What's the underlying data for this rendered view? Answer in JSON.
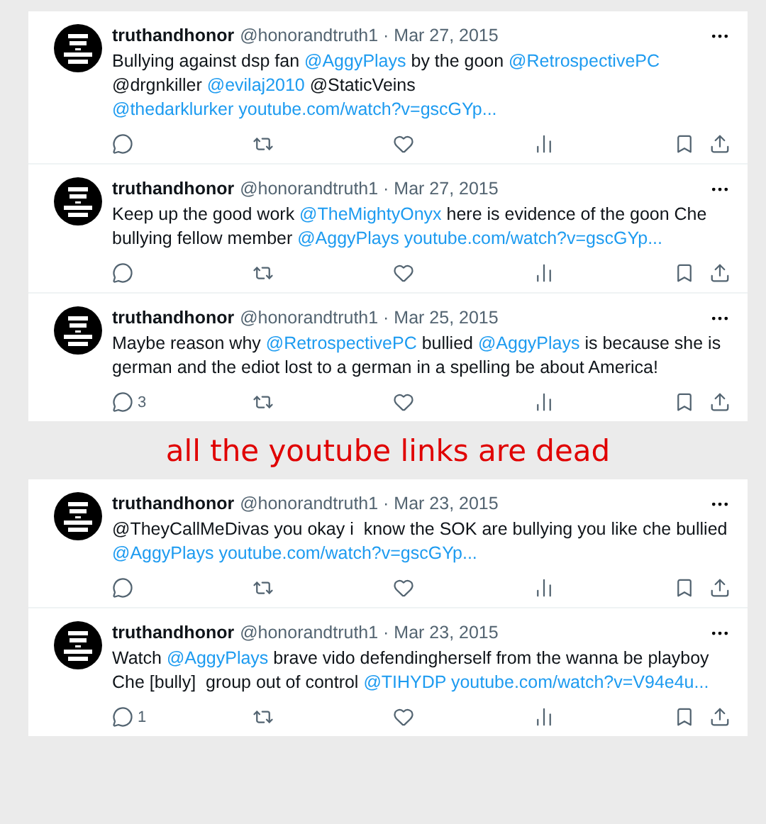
{
  "panels": [
    {
      "tweets": [
        {
          "name": "truthandhonor",
          "handle": "@honorandtruth1 · Mar 27, 2015",
          "segments": [
            {
              "text": "Bullying against dsp fan ",
              "kind": "text"
            },
            {
              "text": "@AggyPlays",
              "kind": "link"
            },
            {
              "text": " by the goon ",
              "kind": "text"
            },
            {
              "text": "@RetrospectivePC",
              "kind": "link"
            },
            {
              "text": " @drgnkiller ",
              "kind": "text"
            },
            {
              "text": "@evilaj2010",
              "kind": "link"
            },
            {
              "text": " @StaticVeins ",
              "kind": "text"
            },
            {
              "text": "@thedarklurker ",
              "kind": "link"
            },
            {
              "text": "youtube.com/watch?v=gscGYp...",
              "kind": "link"
            }
          ]
        },
        {
          "name": "truthandhonor",
          "handle": "@honorandtruth1 · Mar 27, 2015",
          "segments": [
            {
              "text": "Keep up the good work ",
              "kind": "text"
            },
            {
              "text": "@TheMightyOnyx",
              "kind": "link"
            },
            {
              "text": " here is evidence of the goon Che bullying fellow member ",
              "kind": "text"
            },
            {
              "text": "@AggyPlays  ",
              "kind": "link"
            },
            {
              "text": "youtube.com/watch?v=gscGYp...",
              "kind": "link"
            }
          ]
        },
        {
          "name": "truthandhonor",
          "handle": "@honorandtruth1 · Mar 25, 2015",
          "replies": "3",
          "segments": [
            {
              "text": "Maybe reason why ",
              "kind": "text"
            },
            {
              "text": "@RetrospectivePC",
              "kind": "link"
            },
            {
              "text": " bullied ",
              "kind": "text"
            },
            {
              "text": "@AggyPlays",
              "kind": "link"
            },
            {
              "text": " is because she is german and the ediot lost to a german in a spelling be about America!",
              "kind": "text"
            }
          ]
        }
      ]
    },
    {
      "tweets": [
        {
          "name": "truthandhonor",
          "handle": "@honorandtruth1 · Mar 23, 2015",
          "segments": [
            {
              "text": "@TheyCallMeDivas you okay i  know the SOK are bullying you like che bullied ",
              "kind": "text"
            },
            {
              "text": "@AggyPlays ",
              "kind": "link"
            },
            {
              "text": "youtube.com/watch?v=gscGYp...",
              "kind": "link"
            }
          ]
        },
        {
          "name": "truthandhonor",
          "handle": "@honorandtruth1 · Mar 23, 2015",
          "replies": "1",
          "segments": [
            {
              "text": "Watch ",
              "kind": "text"
            },
            {
              "text": "@AggyPlays",
              "kind": "link"
            },
            {
              "text": " brave vido defendingherself from the wanna be playboy Che [bully]  group out of control ",
              "kind": "text"
            },
            {
              "text": "@TIHYDP ",
              "kind": "link"
            },
            {
              "text": "youtube.com/watch?v=V94e4u...",
              "kind": "link"
            }
          ]
        }
      ]
    }
  ],
  "note": "all the youtube links are dead"
}
